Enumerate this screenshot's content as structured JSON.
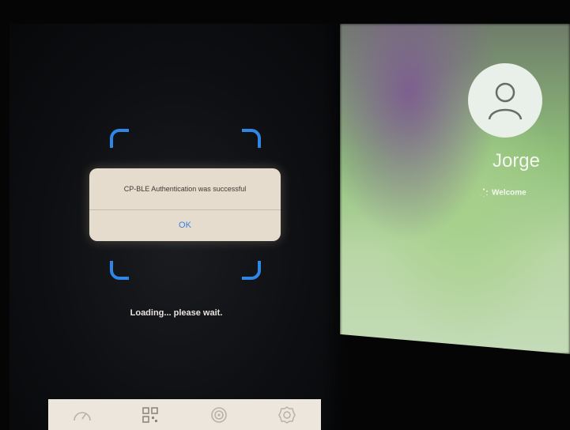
{
  "alert": {
    "message": "CP-BLE Authentication was successful",
    "ok_label": "OK"
  },
  "status": {
    "loading_text": "Loading... please wait."
  },
  "tabbar": {
    "items": [
      {
        "icon": "speedometer-icon"
      },
      {
        "icon": "qr-code-icon"
      },
      {
        "icon": "location-icon"
      },
      {
        "icon": "settings-gear-icon"
      }
    ]
  },
  "login_screen": {
    "user_name": "Jorge",
    "welcome_text": "Welcome"
  },
  "colors": {
    "scan_frame": "#2e86e6",
    "alert_background": "#e6dccd",
    "ok_button": "#3b7fe0",
    "tabbar_background": "#ede6dc"
  }
}
